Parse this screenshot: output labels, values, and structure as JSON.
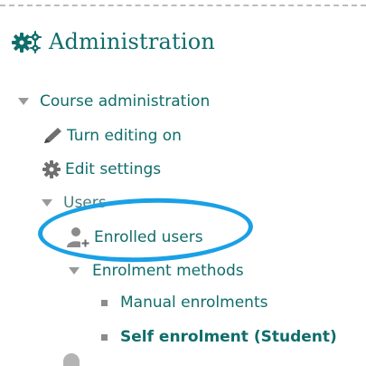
{
  "block": {
    "title": "Administration",
    "icon": "gears-icon"
  },
  "tree": {
    "course_admin": {
      "label": "Course administration",
      "icon": "expand-triangle-icon"
    },
    "turn_editing": {
      "label": "Turn editing on",
      "icon": "pencil-icon"
    },
    "edit_settings": {
      "label": "Edit settings",
      "icon": "gear-icon"
    },
    "users": {
      "label": "Users",
      "icon": "expand-triangle-icon"
    },
    "enrolled_users": {
      "label": "Enrolled users",
      "icon": "user-plus-icon"
    },
    "enrolment_methods": {
      "label": "Enrolment methods",
      "icon": "expand-triangle-icon"
    },
    "manual_enrolments": {
      "label": "Manual enrolments",
      "icon": "bullet-icon"
    },
    "self_enrolment": {
      "label": "Self enrolment (Student)",
      "icon": "bullet-icon"
    }
  },
  "colors": {
    "link": "#0f6d6b",
    "highlight": "#1aa0e6",
    "icon_gray": "#8b8b8b"
  }
}
